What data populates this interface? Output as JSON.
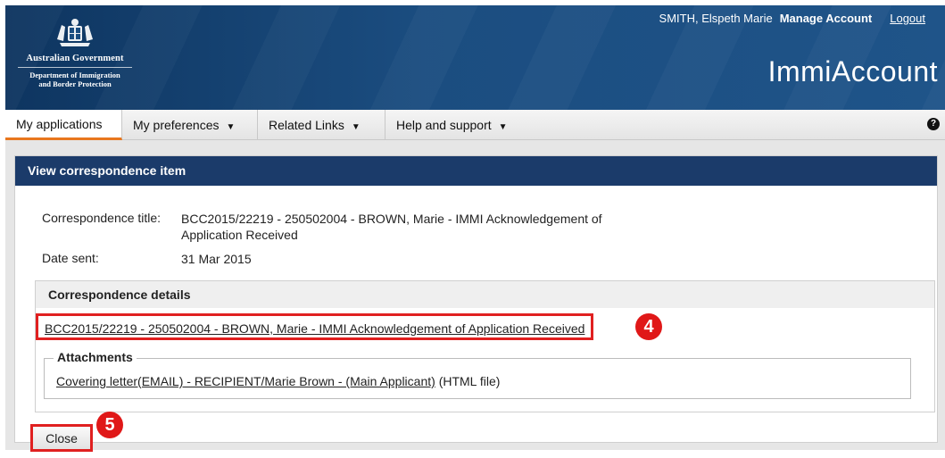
{
  "header": {
    "government": "Australian Government",
    "department_line1": "Department of Immigration",
    "department_line2": "and Border Protection",
    "user_name": "SMITH, Elspeth Marie",
    "manage_account": "Manage Account",
    "logout": "Logout",
    "app_title": "ImmiAccount"
  },
  "nav": {
    "items": [
      {
        "label": "My applications",
        "caret": ""
      },
      {
        "label": "My preferences",
        "caret": "▼"
      },
      {
        "label": "Related Links",
        "caret": "▼"
      },
      {
        "label": "Help and support",
        "caret": "▼"
      }
    ],
    "help_icon": "?"
  },
  "panel": {
    "title": "View correspondence item",
    "correspondence_title_label": "Correspondence title:",
    "correspondence_title_value": "BCC2015/22219 - 250502004 - BROWN, Marie - IMMI Acknowledgement of Application Received",
    "date_sent_label": "Date sent:",
    "date_sent_value": "31 Mar 2015",
    "details_heading": "Correspondence details",
    "correspondence_link": "BCC2015/22219 - 250502004 - BROWN, Marie - IMMI Acknowledgement of Application Received",
    "attachments_legend": "Attachments",
    "attachment_link": "Covering letter(EMAIL) - RECIPIENT/Marie Brown - (Main Applicant)",
    "attachment_type": "(HTML file)",
    "close_button": "Close"
  },
  "annotations": {
    "marker_4": "4",
    "marker_5": "5"
  },
  "colors": {
    "header_blue": "#1b4d80",
    "panel_head": "#1b3b6a",
    "active_tab_accent": "#e8761e",
    "highlight_red": "#e02020"
  }
}
